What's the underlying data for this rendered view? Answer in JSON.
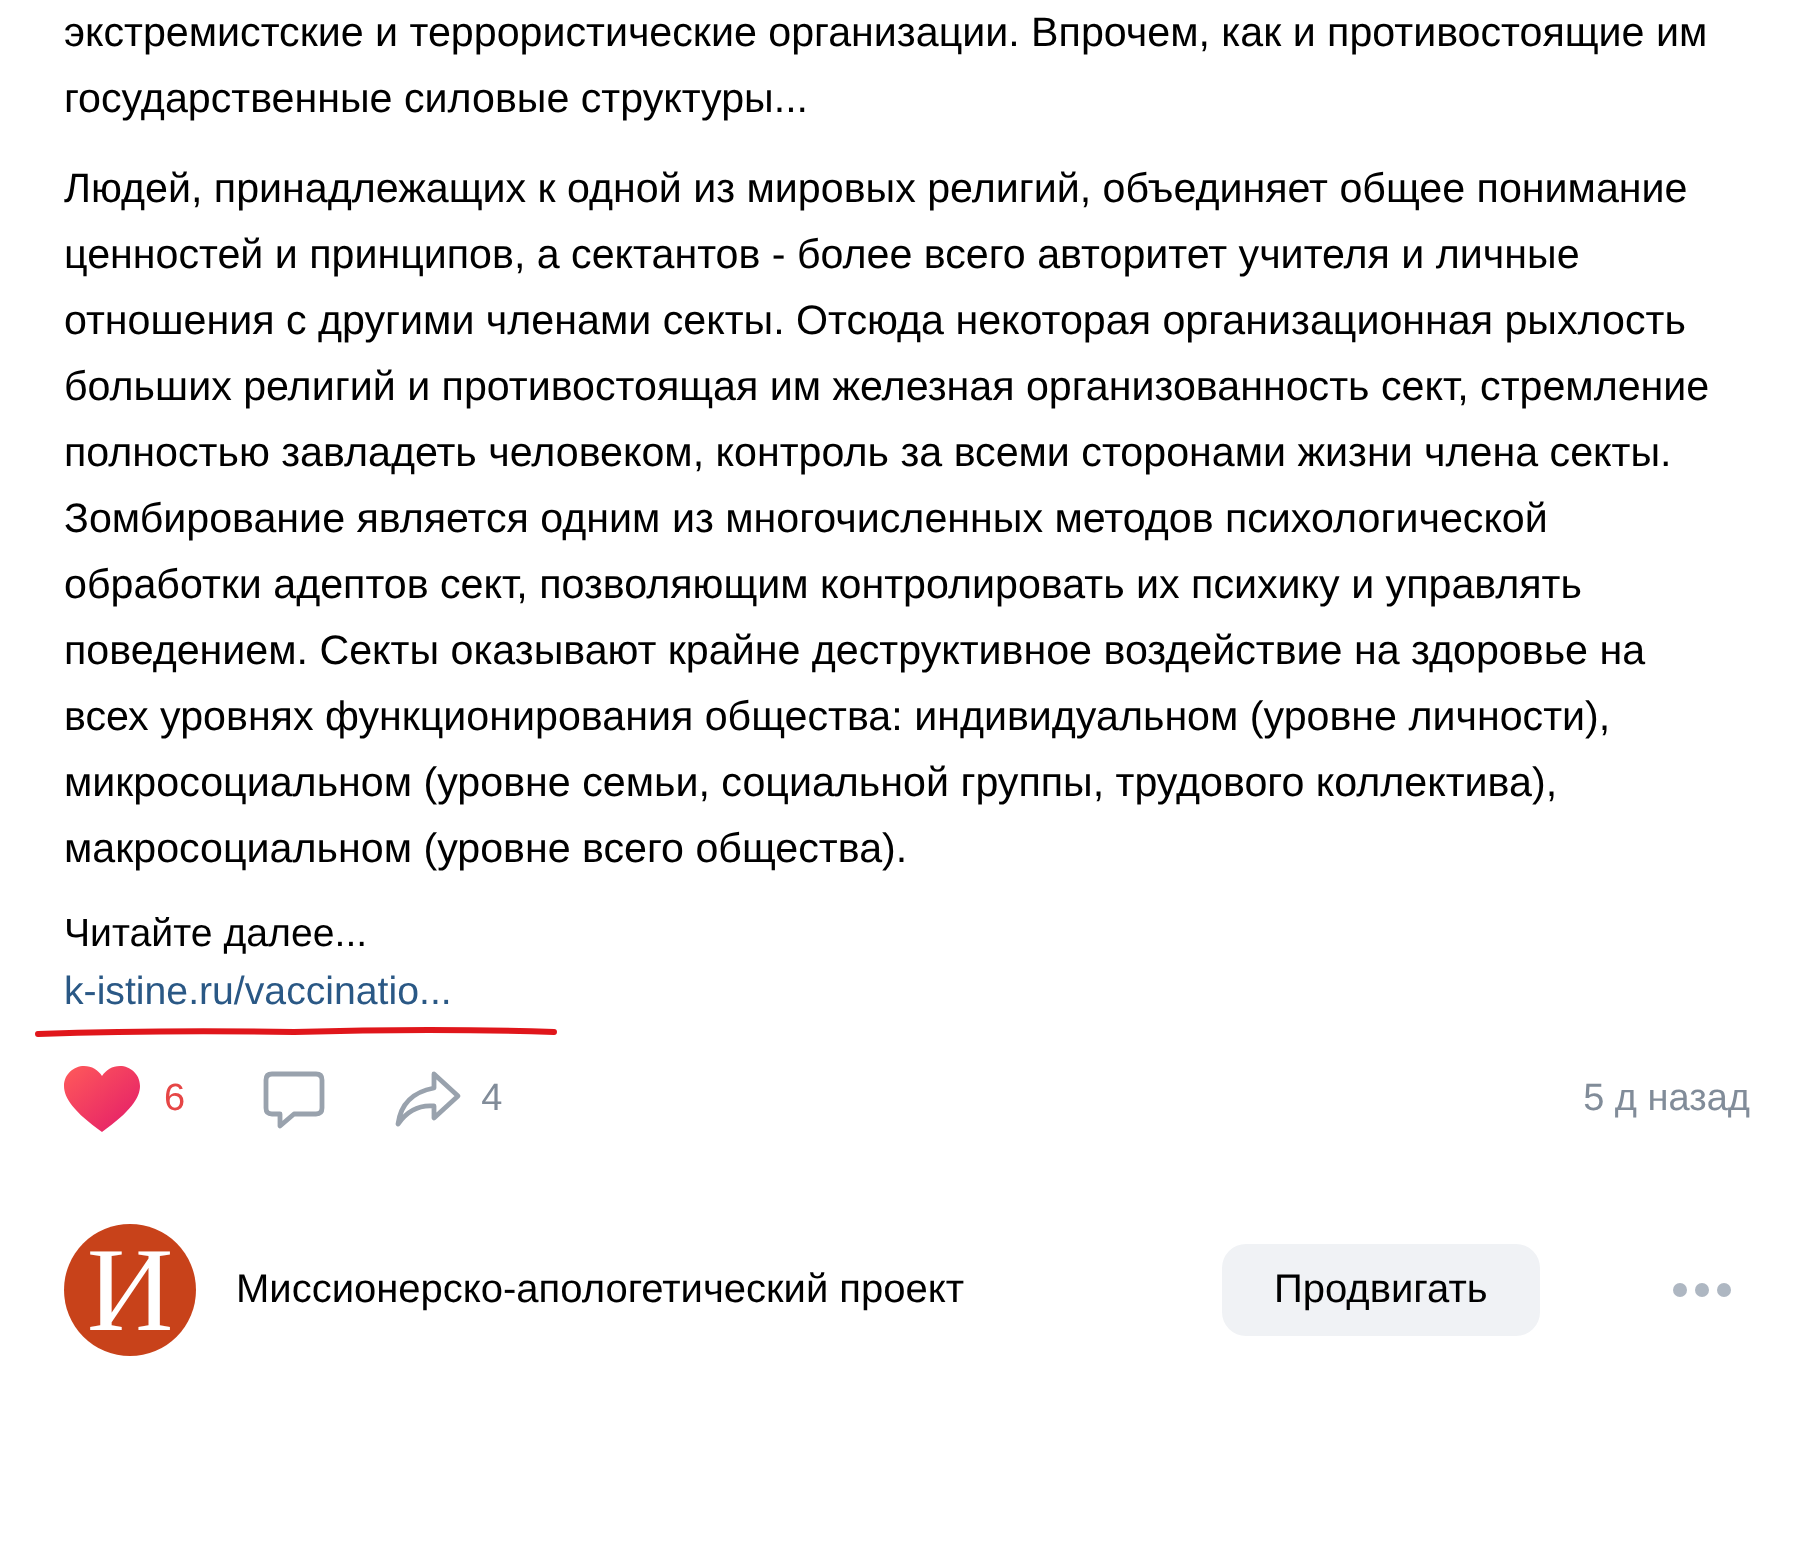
{
  "post": {
    "paragraphs": [
      "экстремистские и террористические организации. Впрочем, как и противостоящие им государственные силовые структуры...",
      "Людей, принадлежащих к одной из мировых религий, объединяет общее понимание ценностей и принципов, а сектантов - более всего авторитет учителя и личные отношения с другими членами секты. Отсюда некоторая организационная рыхлость больших религий и противостоящая им железная организованность сект, стремление полностью завладеть человеком, контроль за всеми сторонами жизни члена секты. Зомбирование является одним из многочисленных методов психологической обработки адептов сект, позволяющим контролировать их психику и управлять поведением. Секты оказывают крайне деструктивное воздействие на здоровье на всех уровнях функционирования общества: индивидуальном (уровне личности), микросоциальном (уровне семьи, социальной группы, трудового коллектива), макросоциальном (уровне всего общества)."
    ],
    "read_more": "Читайте далее...",
    "link": "k-istine.ru/vaccinatio...",
    "link_underlined": true,
    "likes": {
      "count": "6",
      "liked": true
    },
    "reposts": "4",
    "time": "5 д назад"
  },
  "next_post": {
    "logo_letter": "И",
    "author": "Миссионерско-апологетический проект",
    "button": "Продвигать"
  }
}
